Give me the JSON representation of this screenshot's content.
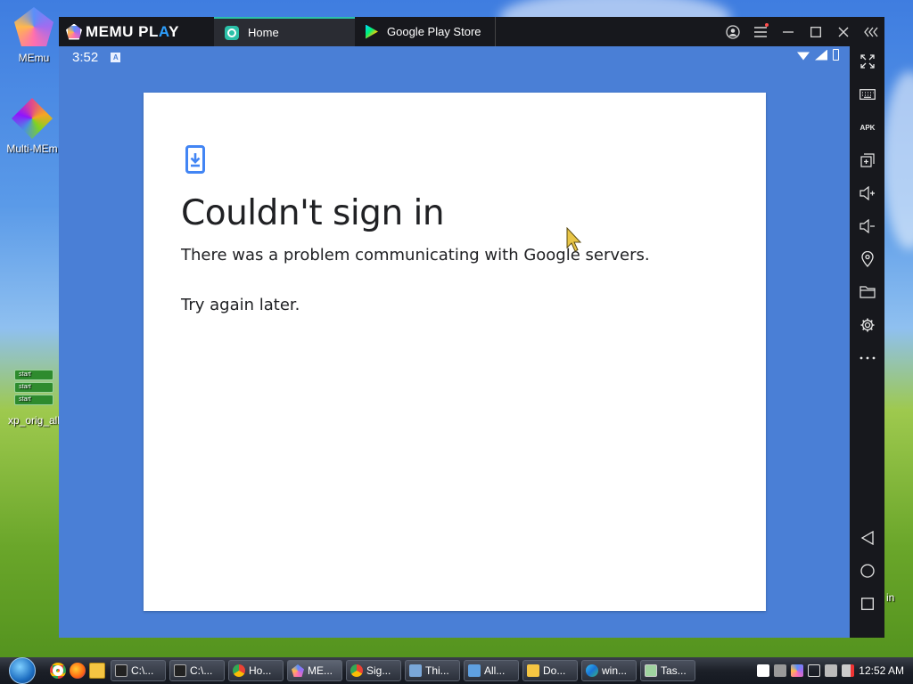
{
  "desktop": {
    "icons": [
      {
        "label": "MEmu",
        "icon": "memu-app-icon"
      },
      {
        "label": "Multi-MEm",
        "icon": "multi-memu-icon"
      },
      {
        "label": "xp_orig_all",
        "icon": "xp-shortcut-icon",
        "thumb_text": [
          "start",
          "start",
          "start"
        ]
      }
    ],
    "partial_label": "in"
  },
  "emulator": {
    "brand": {
      "prefix": "MEMU PL",
      "accent": "A",
      "suffix": "Y"
    },
    "tabs": [
      {
        "label": "Home",
        "icon": "home-app-icon",
        "active": true
      },
      {
        "label": "Google Play Store",
        "icon": "play-store-icon",
        "active": false
      }
    ],
    "titlebar_buttons": [
      "account-icon",
      "menu-icon",
      "minimize-icon",
      "maximize-icon",
      "close-icon",
      "collapse-sidebar-icon"
    ],
    "status_bar": {
      "time": "3:52",
      "notification_letter": "A"
    },
    "dialog": {
      "icon": "phone-download-icon",
      "title": "Couldn't sign in",
      "message": "There was a problem communicating with Google servers.",
      "retry": "Try again later."
    },
    "sidebar_tools": [
      "fullscreen-icon",
      "keyboard-icon",
      "apk-install-icon",
      "multi-window-icon",
      "volume-up-icon",
      "volume-down-icon",
      "location-icon",
      "folder-icon",
      "settings-icon",
      "more-icon"
    ],
    "apk_text": "APK",
    "nav_buttons": [
      "back-icon",
      "home-circle-icon",
      "recents-icon"
    ]
  },
  "taskbar": {
    "quick_launch": [
      "chrome-icon",
      "firefox-icon",
      "explorer-folder-icon"
    ],
    "tasks": [
      {
        "label": "C:\\...",
        "icon": "cmd-icon"
      },
      {
        "label": "C:\\...",
        "icon": "cmd-icon"
      },
      {
        "label": "Ho...",
        "icon": "chrome-icon"
      },
      {
        "label": "ME...",
        "icon": "memu-app-icon"
      },
      {
        "label": "Sig...",
        "icon": "chrome-icon"
      },
      {
        "label": "Thi...",
        "icon": "computer-icon"
      },
      {
        "label": "All...",
        "icon": "control-panel-icon"
      },
      {
        "label": "Do...",
        "icon": "folder-icon"
      },
      {
        "label": "win...",
        "icon": "edge-icon"
      },
      {
        "label": "Tas...",
        "icon": "task-manager-icon"
      }
    ],
    "tray_icons": [
      "flag-icon",
      "network-icon",
      "memu-tray-icon",
      "display-icon",
      "speaker-icon",
      "volume-muted-icon"
    ],
    "clock": "12:52 AM"
  },
  "colors": {
    "screen_bg": "#4a7fd6",
    "tab_accent": "#2bc0a8",
    "dialog_icon": "#4285f4"
  }
}
